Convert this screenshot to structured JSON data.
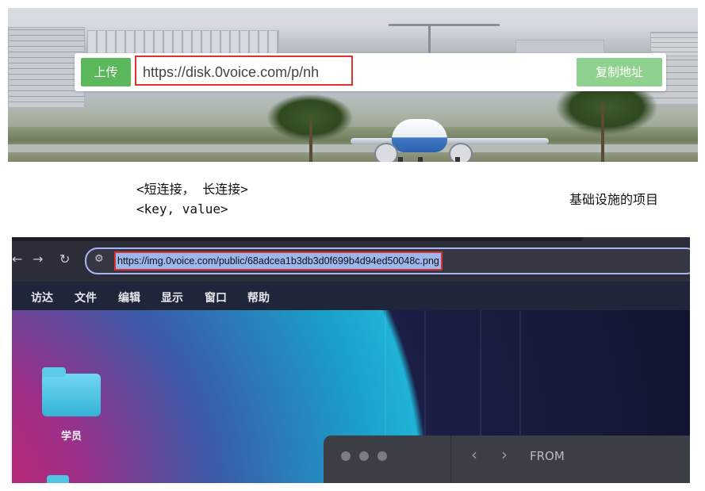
{
  "upload_bar": {
    "upload_label": "上传",
    "url_value": "https://disk.0voice.com/p/nh",
    "copy_label": "复制地址"
  },
  "notes": {
    "line1": "<短连接， 长连接>",
    "line2": "<key, value>",
    "side": "基础设施的项目"
  },
  "browser": {
    "back_icon": "←",
    "forward_icon": "→",
    "reload_icon": "↻",
    "tune_icon": "⚙",
    "address": "https://img.0voice.com/public/68adcea1b3db3d0f699b4d94ed50048c.png"
  },
  "menubar": {
    "items": [
      "访达",
      "文件",
      "编辑",
      "显示",
      "窗口",
      "帮助"
    ]
  },
  "desktop": {
    "folder_label": "学员"
  },
  "finder": {
    "back_icon": "‹",
    "forward_icon": "›",
    "title": "FROM"
  }
}
